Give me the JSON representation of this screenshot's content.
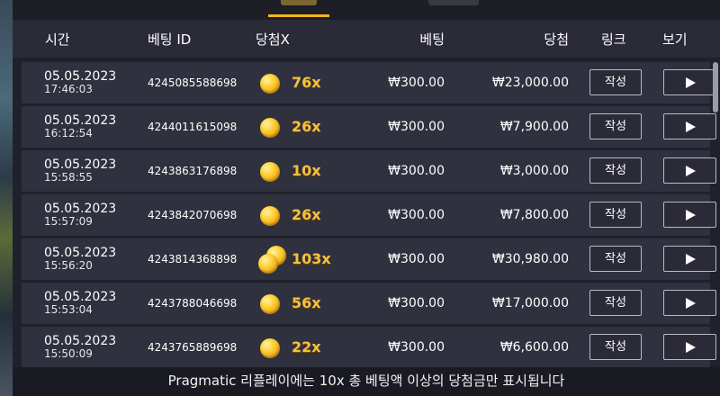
{
  "header": {
    "time": "시간",
    "bet_id": "베팅 ID",
    "multiplier": "당첨X",
    "bet": "베팅",
    "win": "당첨",
    "link": "링크",
    "view": "보기"
  },
  "rows": [
    {
      "date": "05.05.2023",
      "time": "17:46:03",
      "bet_id": "4245085588698",
      "multiplier": "76x",
      "bet": "₩300.00",
      "win": "₩23,000.00",
      "write": "작성"
    },
    {
      "date": "05.05.2023",
      "time": "16:12:54",
      "bet_id": "4244011615098",
      "multiplier": "26x",
      "bet": "₩300.00",
      "win": "₩7,900.00",
      "write": "작성"
    },
    {
      "date": "05.05.2023",
      "time": "15:58:55",
      "bet_id": "4243863176898",
      "multiplier": "10x",
      "bet": "₩300.00",
      "win": "₩3,000.00",
      "write": "작성"
    },
    {
      "date": "05.05.2023",
      "time": "15:57:09",
      "bet_id": "4243842070698",
      "multiplier": "26x",
      "bet": "₩300.00",
      "win": "₩7,800.00",
      "write": "작성"
    },
    {
      "date": "05.05.2023",
      "time": "15:56:20",
      "bet_id": "4243814368898",
      "multiplier": "103x",
      "bet": "₩300.00",
      "win": "₩30,980.00",
      "write": "작성"
    },
    {
      "date": "05.05.2023",
      "time": "15:53:04",
      "bet_id": "4243788046698",
      "multiplier": "56x",
      "bet": "₩300.00",
      "win": "₩17,000.00",
      "write": "작성"
    },
    {
      "date": "05.05.2023",
      "time": "15:50:09",
      "bet_id": "4243765889698",
      "multiplier": "22x",
      "bet": "₩300.00",
      "win": "₩6,600.00",
      "write": "작성"
    }
  ],
  "footer": {
    "note": "Pragmatic 리플레이에는 10x 총 베팅액 이상의 당첨금만 표시됩니다"
  },
  "colors": {
    "accent": "#f2b51d",
    "multiplier": "#f4c043",
    "panel": "#20212b",
    "header": "#2a2b37",
    "row": "#30313e"
  },
  "icons": {
    "coin": "gold-coin-icon",
    "play": "play-icon"
  }
}
